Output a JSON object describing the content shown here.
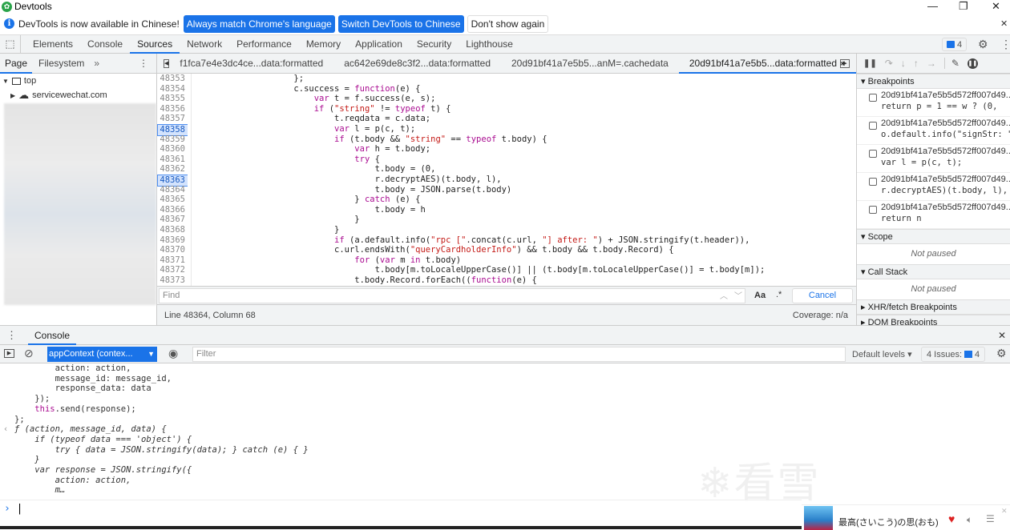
{
  "window": {
    "title": "Devtools",
    "minimize": "—",
    "maximize": "❐",
    "close": "✕"
  },
  "infobar": {
    "message": "DevTools is now available in Chinese!",
    "btn_match": "Always match Chrome's language",
    "btn_switch": "Switch DevTools to Chinese",
    "btn_dismiss": "Don't show again",
    "close": "✕"
  },
  "main_tabs": [
    "Elements",
    "Console",
    "Sources",
    "Network",
    "Performance",
    "Memory",
    "Application",
    "Security",
    "Lighthouse"
  ],
  "active_main_tab": "Sources",
  "issues_count": "4",
  "navigator": {
    "tabs": [
      "Page",
      "Filesystem"
    ],
    "more": "»",
    "tree": {
      "top": "top",
      "domain": "servicewechat.com"
    }
  },
  "editor": {
    "tabs": [
      "f1fca7e4e3dc4ce...data:formatted",
      "ac642e69de8c3f2...data:formatted",
      "20d91bf41a7e5b5...anM=.cachedata",
      "20d91bf41a7e5b5...data:formatted"
    ],
    "active_tab": "20d91bf41a7e5b5...data:formatted",
    "lines": [
      {
        "n": "48353",
        "t": "                    };"
      },
      {
        "n": "48354",
        "t": "                    c.success = function(e) {"
      },
      {
        "n": "48355",
        "t": "                        var t = f.success(e, s);"
      },
      {
        "n": "48356",
        "t": "                        if (\"string\" != typeof t) {"
      },
      {
        "n": "48357",
        "t": "                            t.reqdata = c.data;"
      },
      {
        "n": "48358",
        "t": "                            var l = p(c, t);",
        "bp": true
      },
      {
        "n": "48359",
        "t": "                            if (t.body && \"string\" == typeof t.body) {"
      },
      {
        "n": "48360",
        "t": "                                var h = t.body;"
      },
      {
        "n": "48361",
        "t": "                                try {"
      },
      {
        "n": "48362",
        "t": "                                    t.body = (0,"
      },
      {
        "n": "48363",
        "t": "                                    r.decryptAES)(t.body, l),",
        "bp": true
      },
      {
        "n": "48364",
        "t": "                                    t.body = JSON.parse(t.body)"
      },
      {
        "n": "48365",
        "t": "                                } catch (e) {"
      },
      {
        "n": "48366",
        "t": "                                    t.body = h"
      },
      {
        "n": "48367",
        "t": "                                }"
      },
      {
        "n": "48368",
        "t": "                            }"
      },
      {
        "n": "48369",
        "t": "                            if (a.default.info(\"rpc [\".concat(c.url, \"] after: \") + JSON.stringify(t.header)),"
      },
      {
        "n": "48370",
        "t": "                            c.url.endsWith(\"queryCardholderInfo\") && t.body && t.body.Record) {"
      },
      {
        "n": "48371",
        "t": "                                for (var m in t.body)"
      },
      {
        "n": "48372",
        "t": "                                    t.body[m.toLocaleUpperCase()] || (t.body[m.toLocaleUpperCase()] = t.body[m]);"
      },
      {
        "n": "48373",
        "t": "                                t.body.Record.forEach((function(e) {"
      }
    ],
    "find_placeholder": "Find",
    "match_case": "Aa",
    "regex": ".*",
    "cancel": "Cancel",
    "status": "Line 48364, Column 68",
    "coverage": "Coverage: n/a"
  },
  "debugger": {
    "breakpoints_label": "Breakpoints",
    "breakpoints": [
      {
        "file": "20d91bf41a7e5b5d572ff007d49...",
        "code": "return p = 1 == w ? (0,"
      },
      {
        "file": "20d91bf41a7e5b5d572ff007d49...",
        "code": "o.default.info(\"signStr: \"…"
      },
      {
        "file": "20d91bf41a7e5b5d572ff007d49...",
        "code": "var l = p(c, t);"
      },
      {
        "file": "20d91bf41a7e5b5d572ff007d49...",
        "code": "r.decryptAES)(t.body, l),"
      },
      {
        "file": "20d91bf41a7e5b5d572ff007d49...",
        "code": "return n"
      }
    ],
    "scope_label": "Scope",
    "scope_status": "Not paused",
    "callstack_label": "Call Stack",
    "callstack_status": "Not paused",
    "xhr_label": "XHR/fetch Breakpoints",
    "dom_label": "DOM Breakpoints"
  },
  "drawer": {
    "tab": "Console",
    "close": "✕",
    "context": "appContext (contex...",
    "filter_placeholder": "Filter",
    "levels": "Default levels ▾",
    "issues": "4 Issues:",
    "issues_count": "4",
    "lines": [
      {
        "t": "        action: action,"
      },
      {
        "t": "        message_id: message_id,"
      },
      {
        "t": "        response_data: data"
      },
      {
        "t": "    });"
      },
      {
        "t": "    this.send(response);"
      },
      {
        "t": "};"
      },
      {
        "t": "ƒ (action, message_id, data) {",
        "it": true,
        "ret": true
      },
      {
        "t": "    if (typeof data === 'object') {",
        "it": true
      },
      {
        "t": "        try { data = JSON.stringify(data); } catch (e) { }",
        "it": true
      },
      {
        "t": "    }",
        "it": true
      },
      {
        "t": "    var response = JSON.stringify({",
        "it": true
      },
      {
        "t": "        action: action,",
        "it": true
      },
      {
        "t": "        m…",
        "it": true
      }
    ],
    "prompt": "›"
  },
  "music": {
    "song": "最高(さいこう)の思(おも)い",
    "watermark": "看雪"
  },
  "colors": {
    "accent": "#1a73e8",
    "breakpoint_bg": "#d3e3fd",
    "keyword": "#aa0d91",
    "string": "#c41a16"
  }
}
